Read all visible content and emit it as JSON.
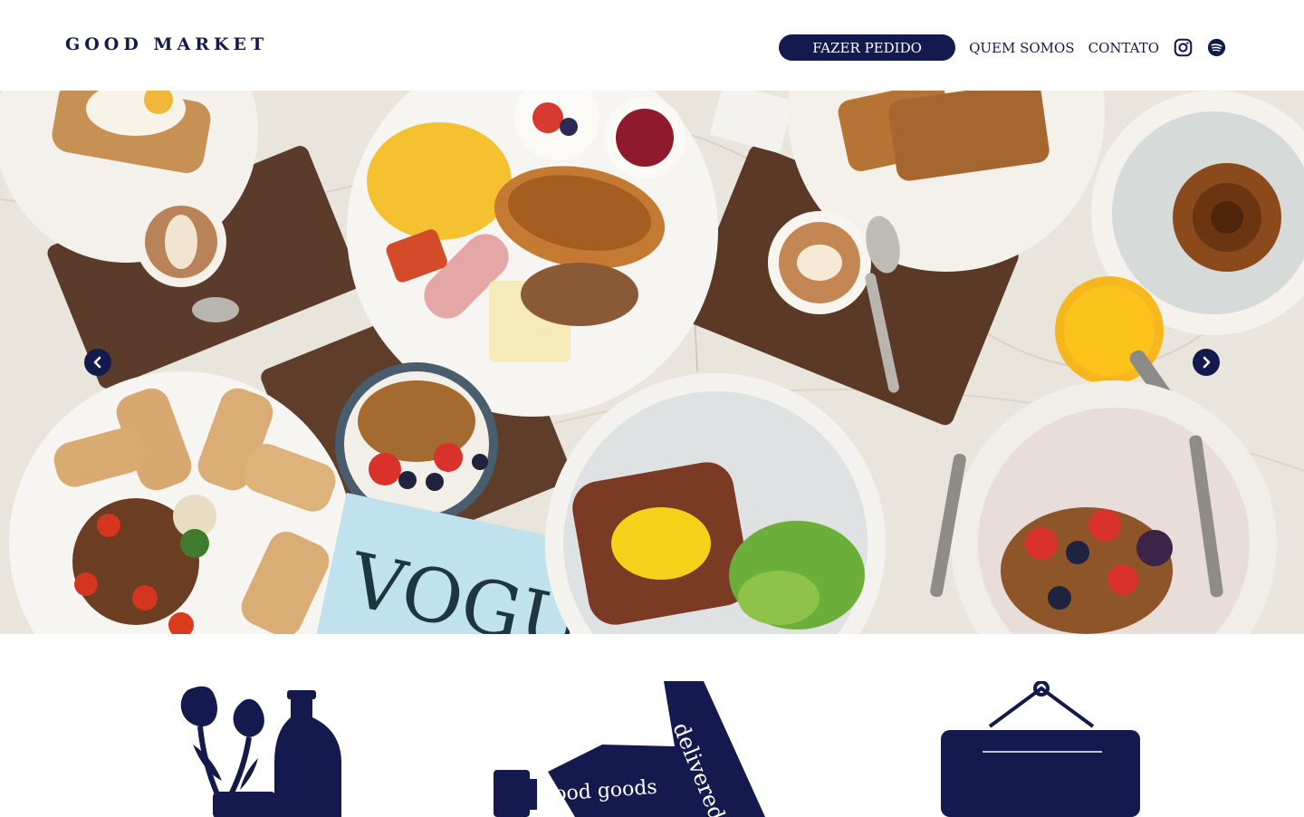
{
  "brand": {
    "logo_text": "GOOD MARKET"
  },
  "nav": {
    "order_label": "FAZER PEDIDO",
    "about_label": "QUEM SOMOS",
    "contact_label": "CONTATO",
    "icons": [
      "instagram-icon",
      "spotify-icon"
    ]
  },
  "hero": {
    "prev_icon": "chevron-left-icon",
    "next_icon": "chevron-right-icon",
    "magazine_text": "VOGUE"
  },
  "features": {
    "delivery_text_1": "good goods",
    "delivery_text_2": "delivered"
  },
  "colors": {
    "brand_navy": "#141a4d",
    "background": "#ffffff",
    "marble": "#e9e4dc"
  }
}
